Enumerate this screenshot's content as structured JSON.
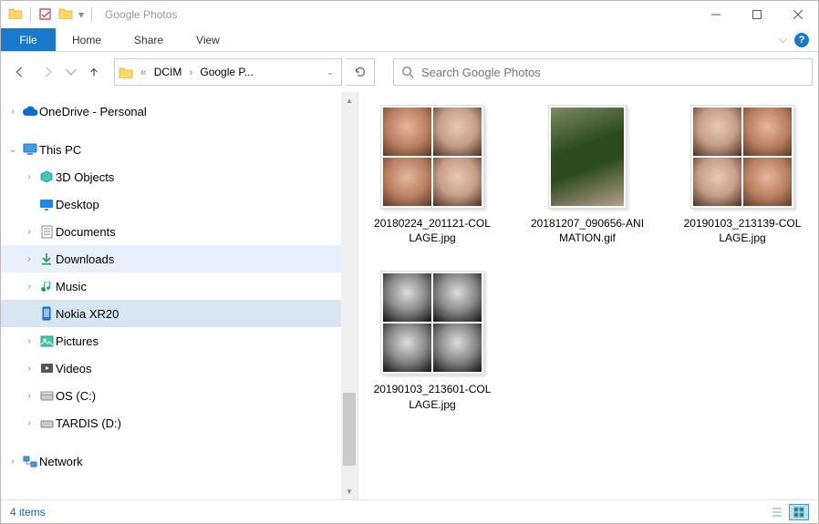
{
  "window": {
    "title": "Google Photos"
  },
  "ribbon": {
    "file": "File",
    "tabs": [
      "Home",
      "Share",
      "View"
    ]
  },
  "breadcrumb": {
    "segments": [
      "DCIM",
      "Google P..."
    ]
  },
  "search": {
    "placeholder": "Search Google Photos"
  },
  "tree": {
    "onedrive": "OneDrive - Personal",
    "thispc": "This PC",
    "children": [
      "3D Objects",
      "Desktop",
      "Documents",
      "Downloads",
      "Music",
      "Nokia XR20",
      "Pictures",
      "Videos",
      "OS (C:)",
      "TARDIS (D:)"
    ],
    "network": "Network"
  },
  "items": [
    {
      "name": "20180224_201121-COLLAGE.jpg",
      "kind": "collage-color"
    },
    {
      "name": "20181207_090656-ANIMATION.gif",
      "kind": "single-tree"
    },
    {
      "name": "20190103_213139-COLLAGE.jpg",
      "kind": "collage-color2"
    },
    {
      "name": "20190103_213601-COLLAGE.jpg",
      "kind": "collage-bw"
    }
  ],
  "status": {
    "count": "4 items"
  }
}
